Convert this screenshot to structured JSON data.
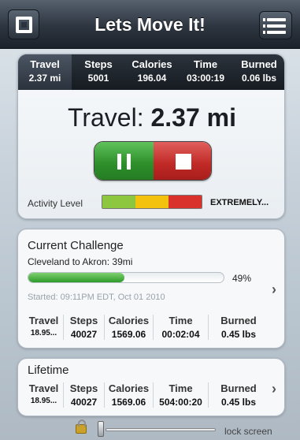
{
  "header": {
    "title": "Lets Move It!",
    "left_icon": "app-logo-icon",
    "right_icon": "menu-list-icon"
  },
  "stats_strip": [
    {
      "label": "Travel",
      "value": "2.37 mi"
    },
    {
      "label": "Steps",
      "value": "5001"
    },
    {
      "label": "Calories",
      "value": "196.04"
    },
    {
      "label": "Time",
      "value": "03:00:19"
    },
    {
      "label": "Burned",
      "value": "0.06 lbs"
    }
  ],
  "main": {
    "metric_label": "Travel:",
    "metric_value": "2.37 mi",
    "pause_icon": "pause-icon",
    "stop_icon": "stop-icon",
    "activity_label": "Activity Level",
    "activity_value": "EXTREMELY...",
    "activity_colors": [
      "#8dc63f",
      "#f2c20f",
      "#d9312b"
    ]
  },
  "challenge": {
    "title": "Current Challenge",
    "route": "Cleveland to Akron: 39mi",
    "progress_percent_text": "49%",
    "progress_fraction": 0.49,
    "started": "Started: 09:11PM EDT, Oct 01 2010",
    "headers": [
      "Travel",
      "Steps",
      "Calories",
      "Time",
      "Burned"
    ],
    "values": [
      "18.95...",
      "40027",
      "1569.06",
      "00:02:04",
      "0.45 lbs"
    ]
  },
  "lifetime": {
    "title": "Lifetime",
    "headers": [
      "Travel",
      "Steps",
      "Calories",
      "Time",
      "Burned"
    ],
    "values": [
      "18.95...",
      "40027",
      "1569.06",
      "504:00:20",
      "0.45 lbs"
    ]
  },
  "lock": {
    "label": "lock screen"
  }
}
